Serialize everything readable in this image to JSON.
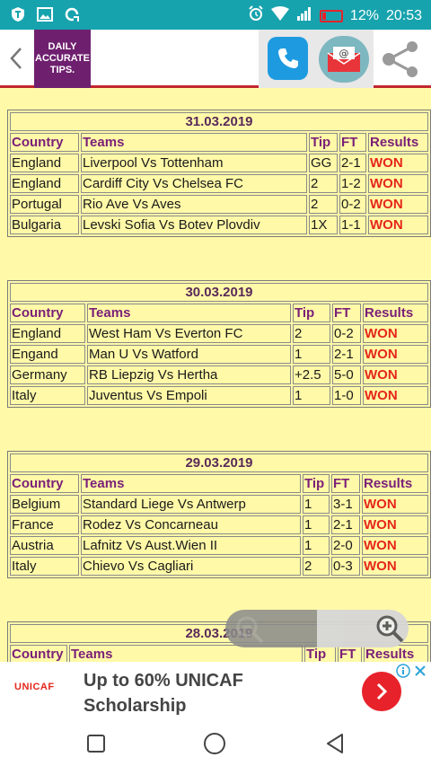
{
  "status": {
    "battery": "12%",
    "time": "20:53",
    "left_icons": [
      "shield-app-icon",
      "gallery-icon",
      "sync-icon"
    ],
    "right_icons": [
      "alarm-icon",
      "wifi-icon",
      "signal-icon",
      "battery-icon"
    ]
  },
  "header": {
    "logo_line1": "DAILY",
    "logo_line2": "ACCURATE",
    "logo_line3": "TIPS.",
    "brand_color": "#6E1F6E"
  },
  "columns": {
    "country": "Country",
    "teams": "Teams",
    "tip": "Tip",
    "ft": "FT",
    "results": "Results"
  },
  "days": [
    {
      "date": "31.03.2019",
      "rows": [
        {
          "country": "England",
          "teams": "Liverpool Vs Tottenham",
          "tip": "GG",
          "ft": "2-1",
          "result": "WON"
        },
        {
          "country": "England",
          "teams": "Cardiff City Vs Chelsea FC",
          "tip": "2",
          "ft": "1-2",
          "result": "WON"
        },
        {
          "country": "Portugal",
          "teams": "Rio Ave Vs Aves",
          "tip": "2",
          "ft": "0-2",
          "result": "WON"
        },
        {
          "country": "Bulgaria",
          "teams": "Levski Sofia Vs Botev Plovdiv",
          "tip": "1X",
          "ft": "1-1",
          "result": "WON"
        }
      ]
    },
    {
      "date": "30.03.2019",
      "rows": [
        {
          "country": "England",
          "teams": "West Ham Vs Everton FC",
          "tip": "2",
          "ft": "0-2",
          "result": "WON"
        },
        {
          "country": "Engand",
          "teams": "Man U Vs Watford",
          "tip": "1",
          "ft": "2-1",
          "result": "WON"
        },
        {
          "country": "Germany",
          "teams": "RB Liepzig Vs Hertha",
          "tip": "+2.5",
          "ft": "5-0",
          "result": "WON"
        },
        {
          "country": "Italy",
          "teams": "Juventus Vs Empoli",
          "tip": "1",
          "ft": "1-0",
          "result": "WON"
        }
      ]
    },
    {
      "date": "29.03.2019",
      "rows": [
        {
          "country": "Belgium",
          "teams": "Standard Liege Vs Antwerp",
          "tip": "1",
          "ft": "3-1",
          "result": "WON"
        },
        {
          "country": "France",
          "teams": "Rodez Vs Concarneau",
          "tip": "1",
          "ft": "2-1",
          "result": "WON"
        },
        {
          "country": "Austria",
          "teams": "Lafnitz Vs Aust.Wien II",
          "tip": "1",
          "ft": "2-0",
          "result": "WON"
        },
        {
          "country": "Italy",
          "teams": "Chievo Vs Cagliari",
          "tip": "2",
          "ft": "0-3",
          "result": "WON"
        }
      ]
    },
    {
      "date": "28.03.2019",
      "rows": []
    }
  ],
  "ad": {
    "brand": "UNICAF",
    "headline_line1": "Up to 60% UNICAF",
    "headline_line2": "Scholarship"
  },
  "colors": {
    "status_bar": "#17A3AE",
    "page_bg": "#FFF9A8",
    "won": "#E5261B",
    "header_text": "#7a1f78",
    "divider": "#C0282E"
  }
}
